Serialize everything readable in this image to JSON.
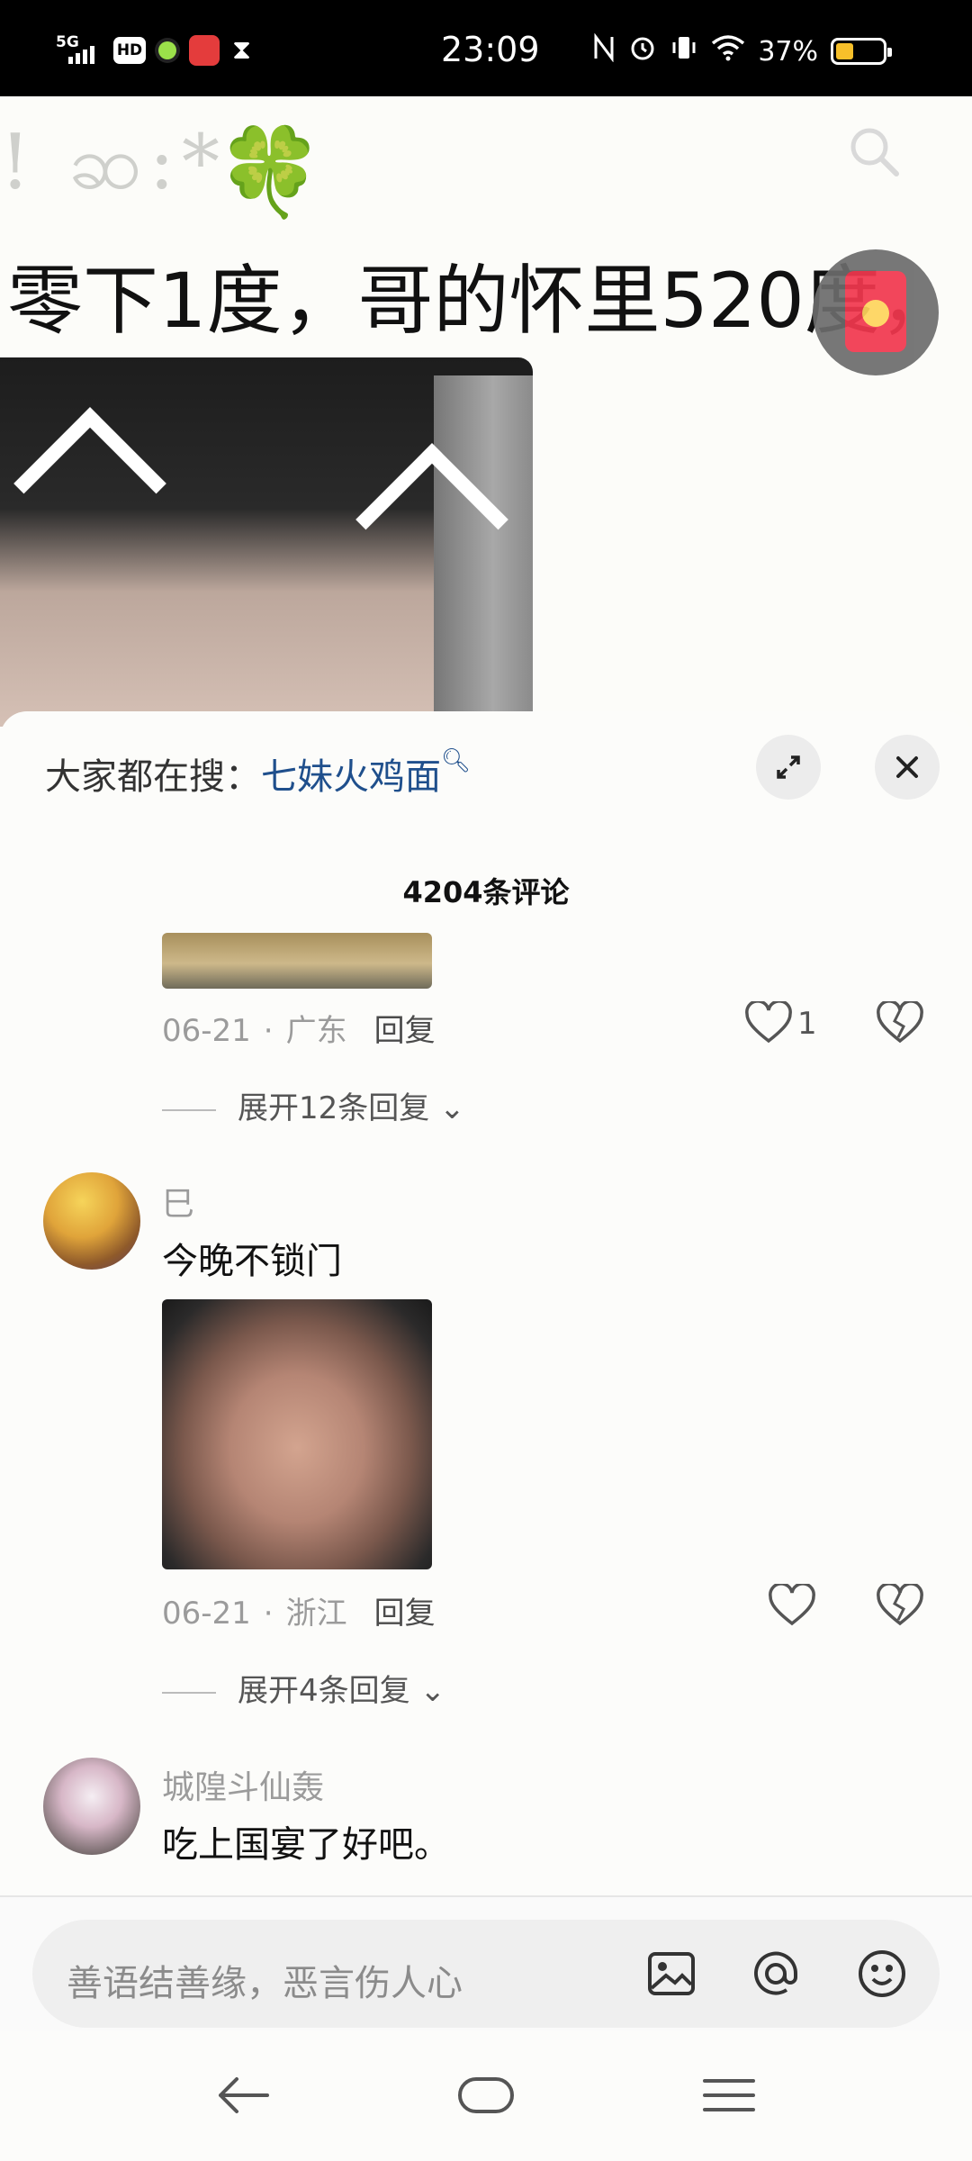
{
  "status_bar": {
    "network": "5G",
    "hd": "HD",
    "time": "23:09",
    "battery_percent": "37%",
    "battery_level": 0.37,
    "icons": [
      "signal-icon",
      "hd-icon",
      "green-dot-icon",
      "app-notification-icon",
      "hourglass-icon",
      "nfc-icon",
      "alarm-icon",
      "vibrate-icon",
      "wifi-icon",
      "battery-icon"
    ]
  },
  "post": {
    "subtitle_glyphs": "! ဆ:*",
    "clover": "🍀",
    "title": "零下1度，哥的怀里520度，"
  },
  "comment_sheet": {
    "trending_label": "大家都在搜：",
    "trending_keyword": "七妹火鸡面",
    "comment_count": "4204条评论",
    "comments": [
      {
        "date": "06-21",
        "location": "广东",
        "reply_label": "回复",
        "likes": "1",
        "expand_label": "展开12条回复"
      },
      {
        "username": "巳",
        "text": "今晚不锁门",
        "date": "06-21",
        "location": "浙江",
        "reply_label": "回复",
        "expand_label": "展开4条回复"
      },
      {
        "username": "城隍斗仙轰",
        "text": "吃上国宴了好吧。"
      }
    ]
  },
  "input_bar": {
    "placeholder": "善语结善缘，恶言伤人心",
    "icons": [
      "image-icon",
      "at-icon",
      "emoji-icon"
    ]
  },
  "nav_bar": {
    "icons": [
      "back-icon",
      "home-icon",
      "menu-icon"
    ]
  },
  "colors": {
    "accent_link": "#1f4f8c",
    "status_bar_bg": "#000000",
    "battery_fill": "#f7c02a",
    "red_packet": "#f2374e"
  }
}
